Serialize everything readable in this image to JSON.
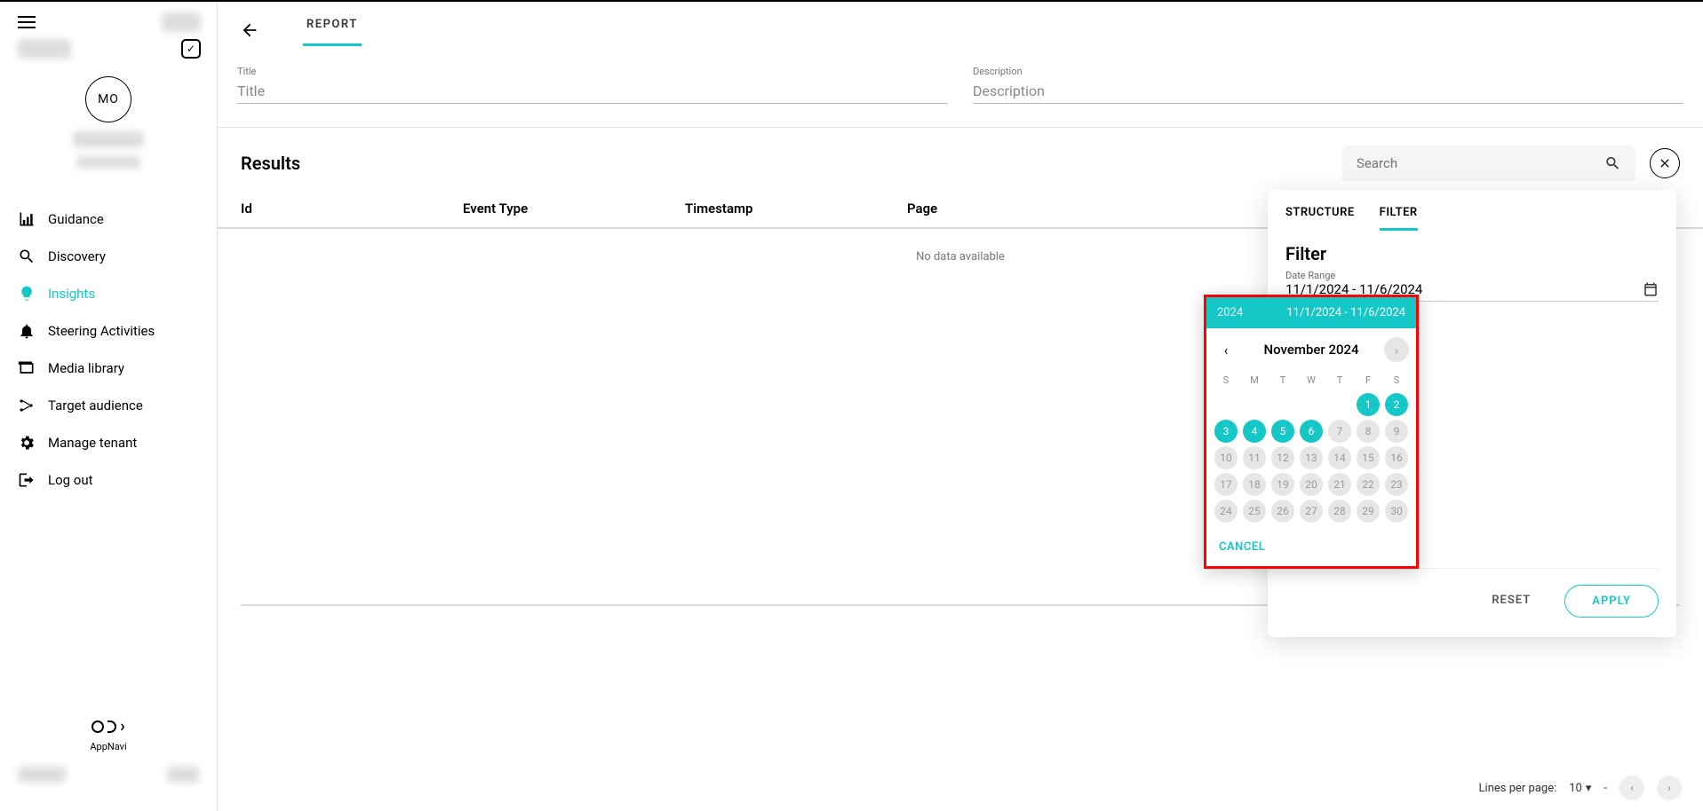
{
  "sidebar": {
    "avatar": "MO",
    "nav": [
      {
        "label": "Guidance",
        "icon": "chart-icon"
      },
      {
        "label": "Discovery",
        "icon": "search-icon"
      },
      {
        "label": "Insights",
        "icon": "bulb-icon",
        "active": true
      },
      {
        "label": "Steering Activities",
        "icon": "bell-icon"
      },
      {
        "label": "Media library",
        "icon": "library-icon"
      },
      {
        "label": "Target audience",
        "icon": "network-icon"
      },
      {
        "label": "Manage tenant",
        "icon": "gear-icon"
      },
      {
        "label": "Log out",
        "icon": "logout-icon"
      }
    ],
    "brand": "AppNavi"
  },
  "header": {
    "tab": "REPORT",
    "title_label": "Title",
    "title_placeholder": "Title",
    "desc_label": "Description",
    "desc_placeholder": "Description"
  },
  "results": {
    "title": "Results",
    "search_placeholder": "Search",
    "columns": [
      "Id",
      "Event Type",
      "Timestamp",
      "Page"
    ],
    "empty": "No data available"
  },
  "panel": {
    "tabs": [
      "STRUCTURE",
      "FILTER"
    ],
    "active_tab": "FILTER",
    "title": "Filter",
    "date_range_label": "Date Range",
    "date_range_value": "11/1/2024 - 11/6/2024",
    "reset": "RESET",
    "apply": "APPLY"
  },
  "datepicker": {
    "year": "2024",
    "range": "11/1/2024 - 11/6/2024",
    "month": "November 2024",
    "dow": [
      "S",
      "M",
      "T",
      "W",
      "T",
      "F",
      "S"
    ],
    "lead_empty": 5,
    "selected": [
      1,
      2,
      3,
      4,
      5,
      6
    ],
    "rest": [
      7,
      8,
      9,
      10,
      11,
      12,
      13,
      14,
      15,
      16,
      17,
      18,
      19,
      20,
      21,
      22,
      23,
      24,
      25,
      26,
      27,
      28,
      29,
      30
    ],
    "cancel": "CANCEL"
  },
  "pager": {
    "label": "Lines per page:",
    "value": "10",
    "dash": "-"
  }
}
